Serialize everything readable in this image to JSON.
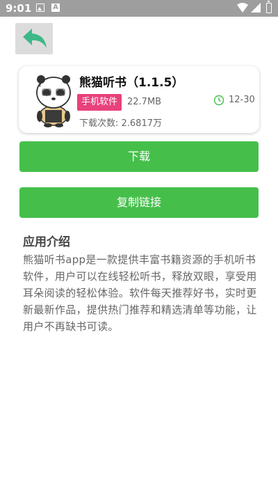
{
  "status_bar": {
    "time": "9:01",
    "a_label": "A",
    "icons": [
      "gallery-icon",
      "a-notification-icon",
      "wifi-icon",
      "signal-icon",
      "battery-icon"
    ]
  },
  "back_button": {
    "icon": "back-arrow-icon",
    "color": "#3fb888"
  },
  "app": {
    "name": "熊猫听书（1.1.5）",
    "category": "手机软件",
    "size": "22.7MB",
    "date": "12-30",
    "downloads": "下载次数: 2.6817万",
    "badge_color": "#e8417b",
    "clock_color": "#45bf4a"
  },
  "buttons": {
    "download": "下载",
    "copy_link": "复制链接",
    "color": "#45bf4a"
  },
  "intro": {
    "title": "应用介绍",
    "text": "熊猫听书app是一款提供丰富书籍资源的手机听书软件，用户可以在线轻松听书，释放双眼，享受用耳朵阅读的轻松体验。软件每天推荐好书，实时更新最新作品，提供热门推荐和精选清单等功能，让用户不再缺书可读。"
  }
}
